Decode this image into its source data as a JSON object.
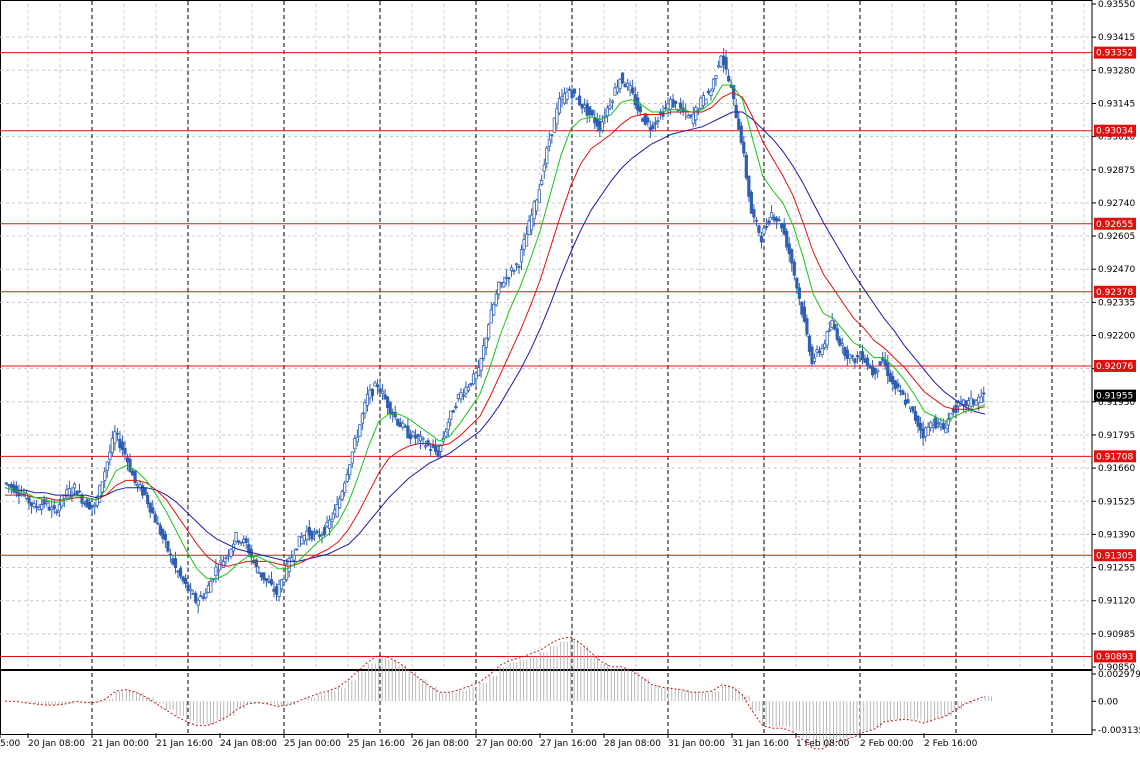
{
  "chart_data": {
    "type": "candlestick",
    "colors": {
      "candle": "#2f5fb3",
      "ma_fast": "#19c219",
      "ma_mid": "#e01010",
      "ma_slow": "#1a1aa6",
      "level_line": "#e01010",
      "level_label_bg": "#e01010",
      "current_label_bg": "#000000",
      "grid": "#c8c8c8",
      "separator": "#000000",
      "osc_line": "#c01818",
      "osc_hist": "#a8a8a8"
    },
    "price_axis": {
      "ylim": [
        0.9085,
        0.9355
      ],
      "tick_labels": [
        "0.93550",
        "0.93415",
        "0.93280",
        "0.93145",
        "0.93010",
        "0.92875",
        "0.92740",
        "0.92605",
        "0.92470",
        "0.92335",
        "0.92200",
        "0.92065",
        "0.91930",
        "0.91795",
        "0.91660",
        "0.91525",
        "0.91390",
        "0.91255",
        "0.91120",
        "0.90985",
        "0.90850"
      ]
    },
    "levels": [
      "0.93352",
      "0.93034",
      "0.92655",
      "0.92378",
      "0.92076",
      "0.91708",
      "0.91305",
      "0.90893"
    ],
    "current_price": "0.91955",
    "x_labels": [
      "5:00",
      "20 Jan 08:00",
      "21 Jan 00:00",
      "21 Jan 16:00",
      "24 Jan 08:00",
      "25 Jan 00:00",
      "25 Jan 16:00",
      "26 Jan 08:00",
      "27 Jan 00:00",
      "27 Jan 16:00",
      "28 Jan 08:00",
      "31 Jan 00:00",
      "31 Jan 16:00",
      "1 Feb 08:00",
      "2 Feb 00:00",
      "2 Feb 16:00"
    ],
    "closes": [
      0.916,
      0.9158,
      0.9155,
      0.915,
      0.9152,
      0.9148,
      0.9155,
      0.9158,
      0.9152,
      0.915,
      0.9165,
      0.918,
      0.9172,
      0.916,
      0.9155,
      0.9145,
      0.9135,
      0.9125,
      0.9118,
      0.9112,
      0.9115,
      0.9125,
      0.913,
      0.9138,
      0.9135,
      0.9125,
      0.912,
      0.9115,
      0.9125,
      0.9135,
      0.914,
      0.9138,
      0.9142,
      0.915,
      0.9165,
      0.918,
      0.9195,
      0.92,
      0.9192,
      0.9185,
      0.918,
      0.9178,
      0.9175,
      0.9172,
      0.9185,
      0.9195,
      0.92,
      0.9205,
      0.9225,
      0.924,
      0.9245,
      0.925,
      0.9265,
      0.928,
      0.93,
      0.9315,
      0.932,
      0.9315,
      0.931,
      0.9305,
      0.9315,
      0.9325,
      0.932,
      0.931,
      0.9305,
      0.931,
      0.9315,
      0.9312,
      0.9308,
      0.9315,
      0.932,
      0.9335,
      0.932,
      0.93,
      0.927,
      0.926,
      0.927,
      0.9265,
      0.925,
      0.923,
      0.921,
      0.9215,
      0.9225,
      0.9215,
      0.921,
      0.9212,
      0.9205,
      0.921,
      0.92,
      0.9195,
      0.9188,
      0.918,
      0.9185,
      0.9182,
      0.919,
      0.9192,
      0.9193,
      0.91955
    ],
    "ma_fast": [
      0.9158,
      0.9157,
      0.9156,
      0.9154,
      0.9153,
      0.9152,
      0.9153,
      0.9155,
      0.9154,
      0.9153,
      0.9157,
      0.9165,
      0.9167,
      0.9165,
      0.9161,
      0.9155,
      0.9148,
      0.914,
      0.9132,
      0.9125,
      0.9121,
      0.9121,
      0.9123,
      0.9127,
      0.913,
      0.913,
      0.9128,
      0.9125,
      0.9125,
      0.9128,
      0.9132,
      0.9136,
      0.9139,
      0.9144,
      0.9152,
      0.9163,
      0.9175,
      0.9185,
      0.9188,
      0.9188,
      0.9186,
      0.9183,
      0.918,
      0.9177,
      0.9179,
      0.9184,
      0.919,
      0.9196,
      0.9207,
      0.922,
      0.9231,
      0.924,
      0.9251,
      0.9263,
      0.9278,
      0.9293,
      0.9304,
      0.9308,
      0.9309,
      0.9308,
      0.931,
      0.9315,
      0.9316,
      0.9314,
      0.9311,
      0.9311,
      0.9312,
      0.9312,
      0.9311,
      0.9312,
      0.9315,
      0.9322,
      0.9322,
      0.9316,
      0.93,
      0.9285,
      0.9279,
      0.9274,
      0.9265,
      0.9252,
      0.9237,
      0.9229,
      0.9227,
      0.9222,
      0.9217,
      0.9215,
      0.9211,
      0.9211,
      0.9207,
      0.9202,
      0.9196,
      0.9189,
      0.9187,
      0.9185,
      0.9187,
      0.9189,
      0.919,
      0.9192
    ],
    "ma_mid": [
      0.9155,
      0.9155,
      0.9155,
      0.9154,
      0.9154,
      0.9153,
      0.9153,
      0.9154,
      0.9154,
      0.9153,
      0.9155,
      0.9159,
      0.9161,
      0.9161,
      0.916,
      0.9157,
      0.9153,
      0.9147,
      0.9141,
      0.9135,
      0.913,
      0.9127,
      0.9126,
      0.9127,
      0.9128,
      0.9128,
      0.9128,
      0.9127,
      0.9126,
      0.9127,
      0.9129,
      0.9131,
      0.9133,
      0.9136,
      0.9141,
      0.9148,
      0.9156,
      0.9164,
      0.917,
      0.9173,
      0.9175,
      0.9176,
      0.9176,
      0.9175,
      0.9176,
      0.9179,
      0.9183,
      0.9187,
      0.9195,
      0.9204,
      0.9213,
      0.9222,
      0.9232,
      0.9243,
      0.9256,
      0.9269,
      0.9281,
      0.929,
      0.9296,
      0.9299,
      0.9302,
      0.9306,
      0.9309,
      0.931,
      0.931,
      0.931,
      0.9311,
      0.9311,
      0.9311,
      0.9311,
      0.9313,
      0.9317,
      0.9319,
      0.9317,
      0.9309,
      0.9299,
      0.9292,
      0.9285,
      0.9277,
      0.9266,
      0.9254,
      0.9245,
      0.9239,
      0.9233,
      0.9227,
      0.9223,
      0.9218,
      0.9215,
      0.9211,
      0.9207,
      0.9202,
      0.9197,
      0.9194,
      0.9191,
      0.919,
      0.919,
      0.919,
      0.9191
    ],
    "ma_slow": [
      0.9158,
      0.9157,
      0.9157,
      0.9156,
      0.9156,
      0.9155,
      0.9155,
      0.9155,
      0.9155,
      0.9154,
      0.9155,
      0.9157,
      0.9158,
      0.9158,
      0.9158,
      0.9157,
      0.9155,
      0.9152,
      0.9148,
      0.9144,
      0.914,
      0.9137,
      0.9135,
      0.9133,
      0.9132,
      0.9131,
      0.913,
      0.9129,
      0.9128,
      0.9128,
      0.9129,
      0.913,
      0.9131,
      0.9133,
      0.9135,
      0.9139,
      0.9144,
      0.9149,
      0.9154,
      0.9158,
      0.9162,
      0.9165,
      0.9168,
      0.917,
      0.9172,
      0.9175,
      0.9178,
      0.9181,
      0.9186,
      0.9192,
      0.9199,
      0.9206,
      0.9214,
      0.9223,
      0.9233,
      0.9244,
      0.9254,
      0.9263,
      0.9271,
      0.9277,
      0.9283,
      0.9288,
      0.9292,
      0.9295,
      0.9298,
      0.93,
      0.9302,
      0.9303,
      0.9304,
      0.9305,
      0.9307,
      0.9309,
      0.9311,
      0.9311,
      0.9308,
      0.9304,
      0.93,
      0.9295,
      0.9289,
      0.9282,
      0.9274,
      0.9266,
      0.9259,
      0.9252,
      0.9245,
      0.9239,
      0.9233,
      0.9227,
      0.9222,
      0.9216,
      0.9211,
      0.9206,
      0.9201,
      0.9197,
      0.9194,
      0.9191,
      0.9189,
      0.9188
    ],
    "oscillator": {
      "tick_labels": [
        "0.002979",
        "0.00",
        "-0.003135"
      ],
      "ylim": [
        -0.003135,
        0.002979
      ]
    }
  }
}
